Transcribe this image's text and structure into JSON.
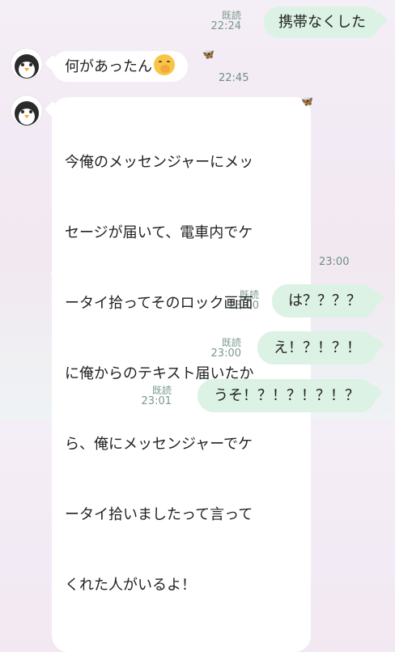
{
  "messages": [
    {
      "side": "out",
      "text": "携帯なくした",
      "read": "既読",
      "time": "22:24"
    },
    {
      "side": "in",
      "text": "何があったん",
      "time": "22:45",
      "emoji": "hand-over-mouth-emoji"
    },
    {
      "side": "in",
      "text": "今俺のメッセンジャーにメッセージが届いて、電車内でケータイ拾ってそのロック画面に俺からのテキスト届いたから、俺にメッセンジャーでケータイ拾いましたって言ってくれた人がいるよ！",
      "time": "23:00"
    },
    {
      "side": "out",
      "text": "は？？？？",
      "read": "既読",
      "time": "23:00"
    },
    {
      "side": "out",
      "text": "え！？！？！",
      "read": "既読",
      "time": "23:00"
    },
    {
      "side": "out",
      "text": "うそ！？！？！？！？",
      "read": "既読",
      "time": "23:01"
    }
  ],
  "long_lines": [
    "今俺のメッセンジャーにメッ",
    "セージが届いて、電車内でケ",
    "ータイ拾ってそのロック画面",
    "に俺からのテキスト届いたか",
    "ら、俺にメッセンジャーでケ",
    "ータイ拾いましたって言って",
    "くれた人がいるよ！"
  ],
  "colors": {
    "outgoing_bubble": "#dcf2e4",
    "incoming_bubble": "#ffffff",
    "meta_text": "#7a9a8c"
  }
}
